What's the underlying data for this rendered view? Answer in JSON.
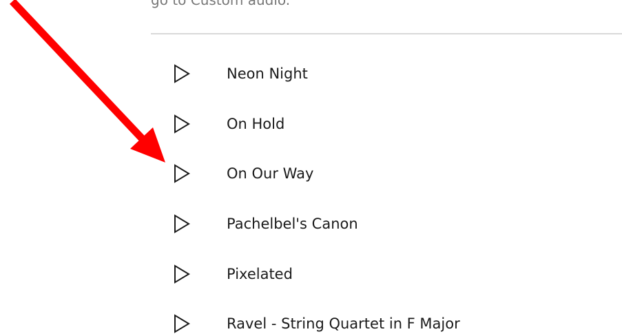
{
  "hint": {
    "text": "go to Custom audio."
  },
  "sounds": {
    "items": [
      {
        "label": "Neon Night",
        "icon": "play-icon"
      },
      {
        "label": "On Hold",
        "icon": "play-icon"
      },
      {
        "label": "On Our Way",
        "icon": "play-icon"
      },
      {
        "label": "Pachelbel's Canon",
        "icon": "play-icon"
      },
      {
        "label": "Pixelated",
        "icon": "play-icon"
      },
      {
        "label": "Ravel - String Quartet in F Major",
        "icon": "play-icon"
      }
    ]
  },
  "annotation": {
    "icon": "red-arrow-icon",
    "color": "#ff0000"
  },
  "colors": {
    "text": "#1a1a1a",
    "hint_text": "#777777",
    "divider": "#d9d9d9",
    "background": "#ffffff"
  }
}
